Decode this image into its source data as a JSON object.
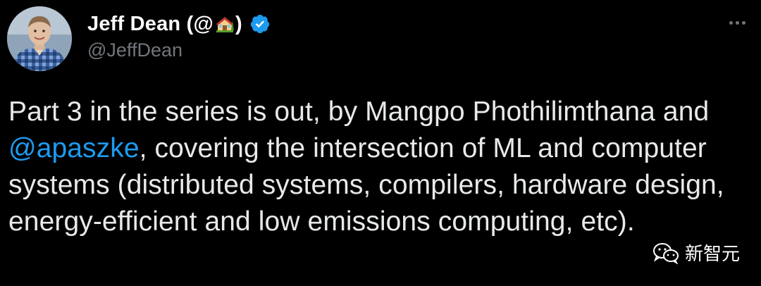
{
  "author": {
    "display_name": "Jeff Dean (@",
    "display_name_suffix": ")",
    "handle": "@JeffDean",
    "avatar_icon": "avatar-photo",
    "house_icon": "house-with-garden-emoji",
    "verified_icon": "verified-badge-icon"
  },
  "menu": {
    "more_icon": "more-horizontal-icon"
  },
  "tweet": {
    "text_part1": "Part 3 in the series is out, by Mangpo Phothilimthana and ",
    "mention": "@apaszke",
    "text_part2": ", covering the intersection of ML and computer systems (distributed systems, compilers, hardware design, energy-efficient and low emissions computing, etc)."
  },
  "watermark": {
    "label": "新智元",
    "icon": "wechat-icon"
  },
  "colors": {
    "background": "#000000",
    "text": "#e7e9ea",
    "secondary": "#71767b",
    "link": "#1d9bf0",
    "verified": "#1d9bf0"
  }
}
